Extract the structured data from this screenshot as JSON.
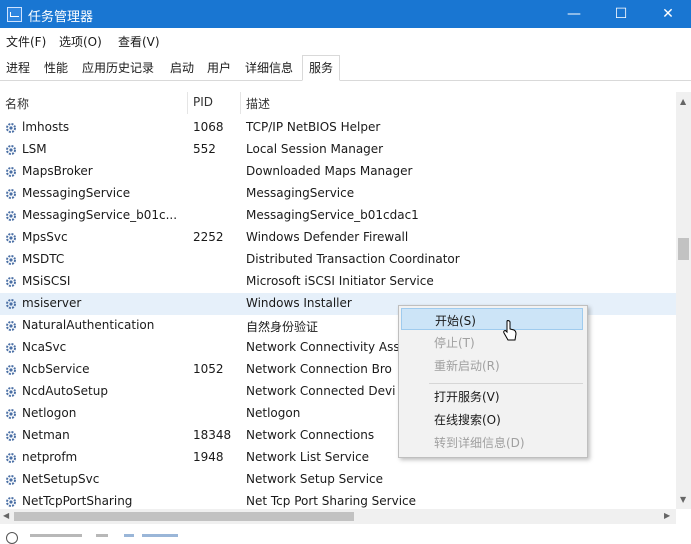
{
  "window": {
    "title": "任务管理器",
    "controls": {
      "minimize": "—",
      "maximize": "☐",
      "close": "✕"
    }
  },
  "menubar": {
    "items": [
      "文件(F)",
      "选项(O)",
      "查看(V)"
    ]
  },
  "tabs": [
    {
      "label": "进程",
      "active": false
    },
    {
      "label": "性能",
      "active": false
    },
    {
      "label": "应用历史记录",
      "active": false
    },
    {
      "label": "启动",
      "active": false
    },
    {
      "label": "用户",
      "active": false
    },
    {
      "label": "详细信息",
      "active": false
    },
    {
      "label": "服务",
      "active": true
    }
  ],
  "columns": {
    "name": "名称",
    "pid": "PID",
    "description": "描述"
  },
  "services": [
    {
      "name": "lmhosts",
      "pid": "1068",
      "description": "TCP/IP NetBIOS Helper"
    },
    {
      "name": "LSM",
      "pid": "552",
      "description": "Local Session Manager"
    },
    {
      "name": "MapsBroker",
      "pid": "",
      "description": "Downloaded Maps Manager"
    },
    {
      "name": "MessagingService",
      "pid": "",
      "description": "MessagingService"
    },
    {
      "name": "MessagingService_b01c...",
      "pid": "",
      "description": "MessagingService_b01cdac1"
    },
    {
      "name": "MpsSvc",
      "pid": "2252",
      "description": "Windows Defender Firewall"
    },
    {
      "name": "MSDTC",
      "pid": "",
      "description": "Distributed Transaction Coordinator"
    },
    {
      "name": "MSiSCSI",
      "pid": "",
      "description": "Microsoft iSCSI Initiator Service"
    },
    {
      "name": "msiserver",
      "pid": "",
      "description": "Windows Installer",
      "selected": true
    },
    {
      "name": "NaturalAuthentication",
      "pid": "",
      "description": "自然身份验证"
    },
    {
      "name": "NcaSvc",
      "pid": "",
      "description": "Network Connectivity Ass"
    },
    {
      "name": "NcbService",
      "pid": "1052",
      "description": "Network Connection Bro"
    },
    {
      "name": "NcdAutoSetup",
      "pid": "",
      "description": "Network Connected Devi"
    },
    {
      "name": "Netlogon",
      "pid": "",
      "description": "Netlogon"
    },
    {
      "name": "Netman",
      "pid": "18348",
      "description": "Network Connections"
    },
    {
      "name": "netprofm",
      "pid": "1948",
      "description": "Network List Service"
    },
    {
      "name": "NetSetupSvc",
      "pid": "",
      "description": "Network Setup Service"
    },
    {
      "name": "NetTcpPortSharing",
      "pid": "",
      "description": "Net Tcp Port Sharing Service"
    }
  ],
  "context_menu": {
    "items": [
      {
        "label": "开始(S)",
        "enabled": true,
        "highlighted": true
      },
      {
        "label": "停止(T)",
        "enabled": false
      },
      {
        "label": "重新启动(R)",
        "enabled": false
      },
      {
        "label": "打开服务(V)",
        "enabled": true
      },
      {
        "label": "在线搜索(O)",
        "enabled": true
      },
      {
        "label": "转到详细信息(D)",
        "enabled": false
      }
    ]
  },
  "colors": {
    "titlebar": "#1976d2",
    "selection": "#e6f0fa",
    "menu_highlight": "#cce4f7"
  },
  "icons": {
    "app": "task-manager-icon",
    "service": "gear-icon"
  }
}
